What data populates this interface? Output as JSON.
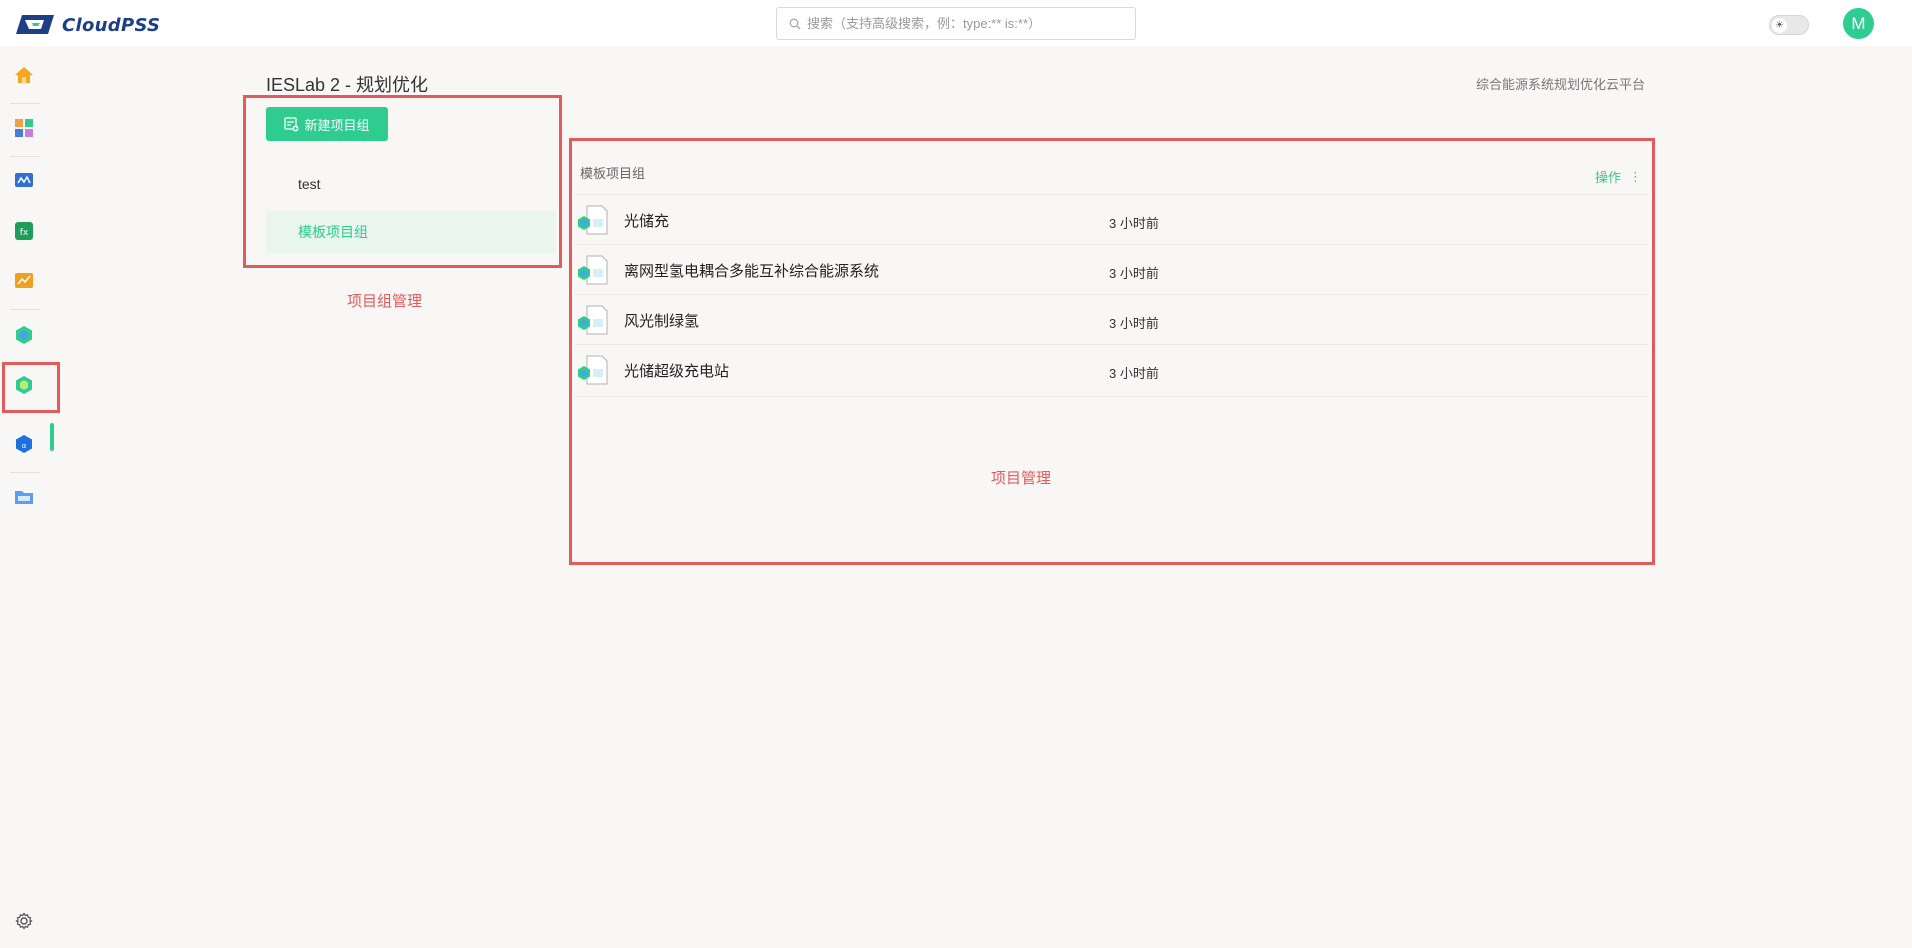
{
  "topbar": {
    "logo_text": "CloudPSS",
    "search_placeholder": "搜索（支持高级搜索，例：type:** is:**）",
    "avatar_letter": "M"
  },
  "sidebar": {
    "items": [
      {
        "icon": "home-icon"
      },
      {
        "icon": "apps-icon"
      },
      {
        "icon": "simulation-icon"
      },
      {
        "icon": "function-icon"
      },
      {
        "icon": "analysis-icon"
      },
      {
        "icon": "ieslab-icon"
      },
      {
        "icon": "ieslab-planning-icon",
        "active": true
      },
      {
        "icon": "cube-app-icon"
      },
      {
        "icon": "folder-icon"
      }
    ],
    "settings_icon": "gear-icon"
  },
  "page": {
    "title": "IESLab 2 - 规划优化",
    "subtitle": "综合能源系统规划优化云平台"
  },
  "groups": {
    "new_button": "新建项目组",
    "items": [
      {
        "label": "test",
        "active": false
      },
      {
        "label": "模板项目组",
        "active": true
      }
    ],
    "annotation": "项目组管理"
  },
  "projects": {
    "group_name": "模板项目组",
    "ops_label": "操作",
    "rows": [
      {
        "name": "光储充",
        "time": "3 小时前"
      },
      {
        "name": "离网型氢电耦合多能互补综合能源系统",
        "time": "3 小时前"
      },
      {
        "name": "风光制绿氢",
        "time": "3 小时前"
      },
      {
        "name": "光储超级充电站",
        "time": "3 小时前"
      }
    ],
    "annotation": "项目管理"
  },
  "colors": {
    "accent": "#2ecc8f",
    "annotation": "#e05b5b",
    "background": "#f9f7f6"
  }
}
